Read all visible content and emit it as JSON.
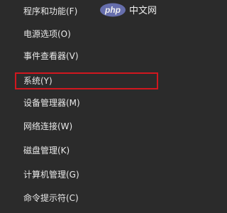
{
  "menu": {
    "items": [
      {
        "label": "程序和功能(F)"
      },
      {
        "label": "电源选项(O)"
      },
      {
        "label": "事件查看器(V)"
      },
      {
        "label": "系统(Y)",
        "highlighted": true
      },
      {
        "label": "设备管理器(M)"
      },
      {
        "label": "网络连接(W)"
      },
      {
        "label": "磁盘管理(K)"
      },
      {
        "label": "计算机管理(G)"
      },
      {
        "label": "命令提示符(C)"
      }
    ]
  },
  "watermark": {
    "text": "php 中文网"
  },
  "colors": {
    "background": "#2b2b2b",
    "text": "#e9e9e9",
    "highlight_border": "#d1171f"
  }
}
